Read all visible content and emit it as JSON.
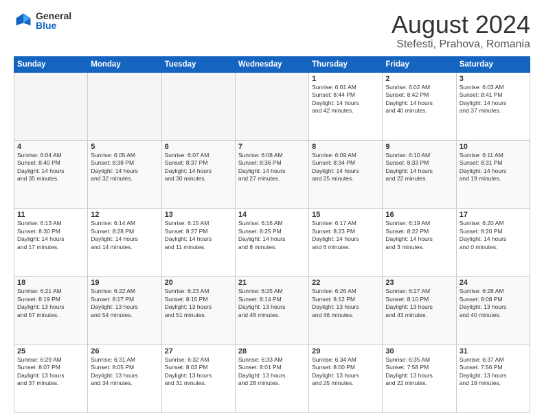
{
  "logo": {
    "general": "General",
    "blue": "Blue"
  },
  "title": "August 2024",
  "subtitle": "Stefesti, Prahova, Romania",
  "days_of_week": [
    "Sunday",
    "Monday",
    "Tuesday",
    "Wednesday",
    "Thursday",
    "Friday",
    "Saturday"
  ],
  "weeks": [
    [
      {
        "day": "",
        "info": ""
      },
      {
        "day": "",
        "info": ""
      },
      {
        "day": "",
        "info": ""
      },
      {
        "day": "",
        "info": ""
      },
      {
        "day": "1",
        "info": "Sunrise: 6:01 AM\nSunset: 8:44 PM\nDaylight: 14 hours\nand 42 minutes."
      },
      {
        "day": "2",
        "info": "Sunrise: 6:02 AM\nSunset: 8:42 PM\nDaylight: 14 hours\nand 40 minutes."
      },
      {
        "day": "3",
        "info": "Sunrise: 6:03 AM\nSunset: 8:41 PM\nDaylight: 14 hours\nand 37 minutes."
      }
    ],
    [
      {
        "day": "4",
        "info": "Sunrise: 6:04 AM\nSunset: 8:40 PM\nDaylight: 14 hours\nand 35 minutes."
      },
      {
        "day": "5",
        "info": "Sunrise: 6:05 AM\nSunset: 8:38 PM\nDaylight: 14 hours\nand 32 minutes."
      },
      {
        "day": "6",
        "info": "Sunrise: 6:07 AM\nSunset: 8:37 PM\nDaylight: 14 hours\nand 30 minutes."
      },
      {
        "day": "7",
        "info": "Sunrise: 6:08 AM\nSunset: 8:36 PM\nDaylight: 14 hours\nand 27 minutes."
      },
      {
        "day": "8",
        "info": "Sunrise: 6:09 AM\nSunset: 8:34 PM\nDaylight: 14 hours\nand 25 minutes."
      },
      {
        "day": "9",
        "info": "Sunrise: 6:10 AM\nSunset: 8:33 PM\nDaylight: 14 hours\nand 22 minutes."
      },
      {
        "day": "10",
        "info": "Sunrise: 6:11 AM\nSunset: 8:31 PM\nDaylight: 14 hours\nand 19 minutes."
      }
    ],
    [
      {
        "day": "11",
        "info": "Sunrise: 6:13 AM\nSunset: 8:30 PM\nDaylight: 14 hours\nand 17 minutes."
      },
      {
        "day": "12",
        "info": "Sunrise: 6:14 AM\nSunset: 8:28 PM\nDaylight: 14 hours\nand 14 minutes."
      },
      {
        "day": "13",
        "info": "Sunrise: 6:15 AM\nSunset: 8:27 PM\nDaylight: 14 hours\nand 11 minutes."
      },
      {
        "day": "14",
        "info": "Sunrise: 6:16 AM\nSunset: 8:25 PM\nDaylight: 14 hours\nand 8 minutes."
      },
      {
        "day": "15",
        "info": "Sunrise: 6:17 AM\nSunset: 8:23 PM\nDaylight: 14 hours\nand 6 minutes."
      },
      {
        "day": "16",
        "info": "Sunrise: 6:19 AM\nSunset: 8:22 PM\nDaylight: 14 hours\nand 3 minutes."
      },
      {
        "day": "17",
        "info": "Sunrise: 6:20 AM\nSunset: 8:20 PM\nDaylight: 14 hours\nand 0 minutes."
      }
    ],
    [
      {
        "day": "18",
        "info": "Sunrise: 6:21 AM\nSunset: 8:19 PM\nDaylight: 13 hours\nand 57 minutes."
      },
      {
        "day": "19",
        "info": "Sunrise: 6:22 AM\nSunset: 8:17 PM\nDaylight: 13 hours\nand 54 minutes."
      },
      {
        "day": "20",
        "info": "Sunrise: 6:23 AM\nSunset: 8:15 PM\nDaylight: 13 hours\nand 51 minutes."
      },
      {
        "day": "21",
        "info": "Sunrise: 6:25 AM\nSunset: 8:14 PM\nDaylight: 13 hours\nand 48 minutes."
      },
      {
        "day": "22",
        "info": "Sunrise: 6:26 AM\nSunset: 8:12 PM\nDaylight: 13 hours\nand 46 minutes."
      },
      {
        "day": "23",
        "info": "Sunrise: 6:27 AM\nSunset: 8:10 PM\nDaylight: 13 hours\nand 43 minutes."
      },
      {
        "day": "24",
        "info": "Sunrise: 6:28 AM\nSunset: 8:08 PM\nDaylight: 13 hours\nand 40 minutes."
      }
    ],
    [
      {
        "day": "25",
        "info": "Sunrise: 6:29 AM\nSunset: 8:07 PM\nDaylight: 13 hours\nand 37 minutes."
      },
      {
        "day": "26",
        "info": "Sunrise: 6:31 AM\nSunset: 8:05 PM\nDaylight: 13 hours\nand 34 minutes."
      },
      {
        "day": "27",
        "info": "Sunrise: 6:32 AM\nSunset: 8:03 PM\nDaylight: 13 hours\nand 31 minutes."
      },
      {
        "day": "28",
        "info": "Sunrise: 6:33 AM\nSunset: 8:01 PM\nDaylight: 13 hours\nand 28 minutes."
      },
      {
        "day": "29",
        "info": "Sunrise: 6:34 AM\nSunset: 8:00 PM\nDaylight: 13 hours\nand 25 minutes."
      },
      {
        "day": "30",
        "info": "Sunrise: 6:35 AM\nSunset: 7:58 PM\nDaylight: 13 hours\nand 22 minutes."
      },
      {
        "day": "31",
        "info": "Sunrise: 6:37 AM\nSunset: 7:56 PM\nDaylight: 13 hours\nand 19 minutes."
      }
    ]
  ]
}
